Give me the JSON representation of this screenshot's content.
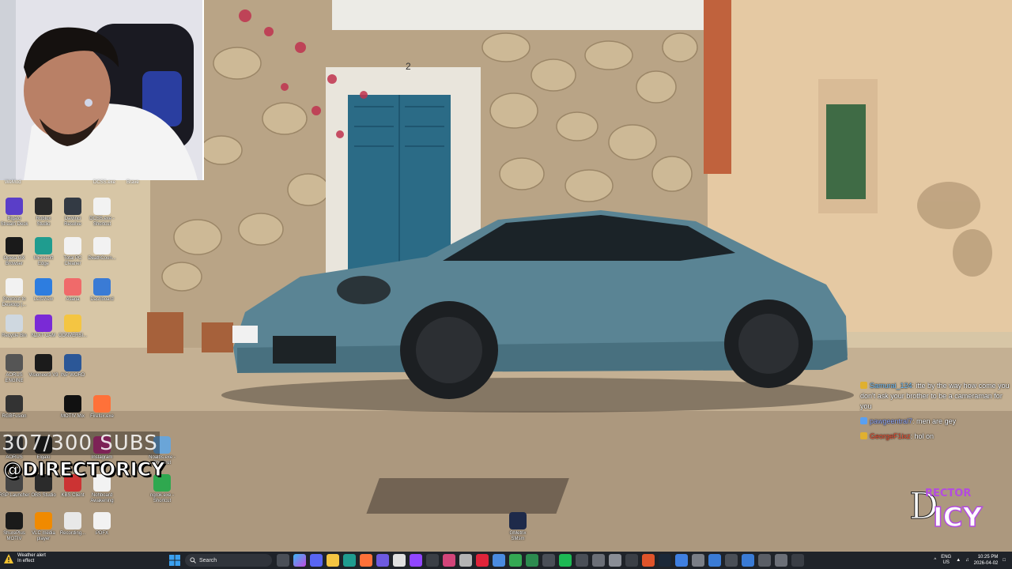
{
  "webcam": {
    "label": "WeMod"
  },
  "top_labels": [
    "DCSS.exe",
    "Brave"
  ],
  "desktop_icons": [
    {
      "label": "Bigato\nStream Deck",
      "icon": "stream-deck-icon",
      "color": "#5a3ec8"
    },
    {
      "label": "Roblox\nStudio",
      "icon": "roblox-studio-icon",
      "color": "#2a2a2a"
    },
    {
      "label": "DaVinci\nResolve",
      "icon": "davinci-icon",
      "color": "#333a44"
    },
    {
      "label": "DCSS.exe -\nShortcut",
      "icon": "file-icon",
      "color": "#f2f2f2"
    },
    {
      "label": "Opera GX\nBrowser",
      "icon": "opera-gx-icon",
      "color": "#1a1a1a"
    },
    {
      "label": "Microsoft\nEdge",
      "icon": "edge-icon",
      "color": "#1f9c8f"
    },
    {
      "label": "Total PC\nCleaner",
      "icon": "file-icon",
      "color": "#f2f2f2"
    },
    {
      "label": "DeathCoun...",
      "icon": "file-icon",
      "color": "#f2f2f2"
    },
    {
      "label": "Shortcut to\nDesktop (...",
      "icon": "file-icon",
      "color": "#f2f2f2"
    },
    {
      "label": "LetsView",
      "icon": "letsview-icon",
      "color": "#2d7de0"
    },
    {
      "label": "Asana",
      "icon": "asana-icon",
      "color": "#f06a6a"
    },
    {
      "label": "Dashboard",
      "icon": "dashboard-icon",
      "color": "#3a7bd5"
    },
    {
      "label": "Recycle Bin",
      "icon": "recycle-bin-icon",
      "color": "#cfd8e0"
    },
    {
      "label": "NZXT CAM",
      "icon": "nzxt-icon",
      "color": "#7a2ad6"
    },
    {
      "label": "CONVERSI...",
      "icon": "folder-icon",
      "color": "#f4c542"
    },
    {
      "label": "AORUS\nENGINE",
      "icon": "aorus-icon",
      "color": "#555"
    },
    {
      "label": "Visioneer3 V3",
      "icon": "visioneer-icon",
      "color": "#1b1b1b"
    },
    {
      "label": "INP WORD",
      "icon": "word-icon",
      "color": "#2b5797"
    },
    {
      "label": "RGBFusion",
      "icon": "rgb-fusion-icon",
      "color": "#333"
    },
    {
      "label": "MOTIV Mix",
      "icon": "motiv-mix-icon",
      "color": "#111"
    },
    {
      "label": "Firefox.exe",
      "icon": "firefox-icon",
      "color": "#ff7139"
    },
    {
      "label": "AORUS",
      "icon": "aorus-icon",
      "color": "#444"
    },
    {
      "label": "Elgato",
      "icon": "elgato-icon",
      "color": "#222"
    },
    {
      "label": "Instagram",
      "icon": "instagram-icon",
      "color": "#c13584"
    },
    {
      "label": "Noalbs.exe -\nShortcut",
      "icon": "file-icon",
      "color": "#6aa5d8"
    },
    {
      "label": "RSP Launcher",
      "icon": "launcher-icon",
      "color": "#444"
    },
    {
      "label": "OBS Studio",
      "icon": "obs-icon",
      "color": "#2b2b2b"
    },
    {
      "label": "KBS Client",
      "icon": "kbs-icon",
      "color": "#c33"
    },
    {
      "label": "Nohboard\nAwakening",
      "icon": "file-icon",
      "color": "#f2f2f2"
    },
    {
      "label": "ngrok.exe -\nShortcut",
      "icon": "ngrok-icon",
      "color": "#2fa84f"
    },
    {
      "label": "ShurePlus\nMOTIV",
      "icon": "shure-icon",
      "color": "#1a1a1a"
    },
    {
      "label": "VLC media\nplayer",
      "icon": "vlc-icon",
      "color": "#f08a00"
    },
    {
      "label": "Recording...",
      "icon": "recording-icon",
      "color": "#e8e8e8"
    },
    {
      "label": "PDFX",
      "icon": "file-icon",
      "color": "#f2f2f2"
    },
    {
      "label": "GMetrix\nSMsm",
      "icon": "gmetrix-icon",
      "color": "#1e2a4a"
    }
  ],
  "overlay": {
    "subs": "307/300 SUBS",
    "handle": "@DIRECTORICY"
  },
  "chat": [
    {
      "user": "Samurai_124",
      "user_color": "#7ec8ff",
      "text": ": itte by the way how come you don't ask your brother to be a cameraman for you",
      "badge_color": "#e0b030"
    },
    {
      "user": "pawgeentral7",
      "user_color": "#9ab0ff",
      "text": ": men are gey",
      "badge_color": "#5aa0f0"
    },
    {
      "user": "GeorgeF1ixz",
      "user_color": "#ff5a3c",
      "text": ": hol on",
      "badge_color": "#e0b030"
    }
  ],
  "logo": {
    "text_top": "RECTOR",
    "text_main": "D ICY",
    "color": "#b44be0"
  },
  "taskbar": {
    "weather_title": "Weather alert",
    "weather_sub": "In effect",
    "search_placeholder": "Search",
    "lang_top": "ENG",
    "lang_bottom": "US",
    "time": "10:25 PM",
    "date": "2026-04-02"
  },
  "colors": {
    "taskbar_bg": "#1f2329",
    "accent": "#0078d4"
  }
}
